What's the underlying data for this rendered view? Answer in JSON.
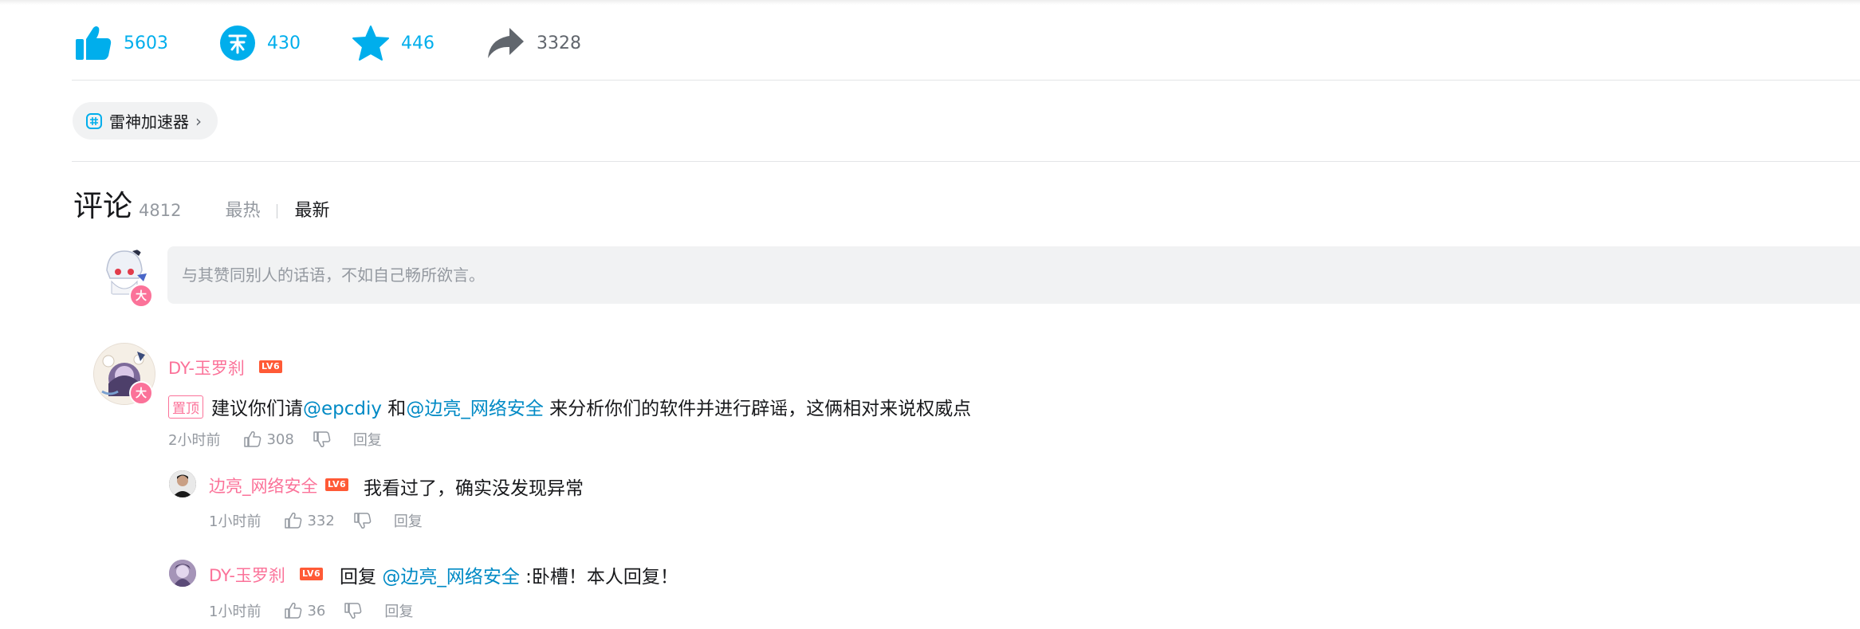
{
  "toolbar": {
    "like_count": "5603",
    "coin_count": "430",
    "favorite_count": "446",
    "share_count": "3328",
    "coin_glyph": "币",
    "accent_color": "#00aeec"
  },
  "tag": {
    "label": "雷神加速器"
  },
  "comments": {
    "title": "评论",
    "count": "4812",
    "sort_hot": "最热",
    "sort_new": "最新",
    "reply_placeholder": "与其赞同别人的话语，不如自己畅所欲言。",
    "avatar_badge": "大"
  },
  "comment_list": [
    {
      "username": "DY-玉罗刹",
      "level": "LV6",
      "pin_label": "置顶",
      "text_1": "建议你们请",
      "mention_1": "@epcdiy",
      "text_2": " 和",
      "mention_2": "@边亮_网络安全",
      "text_3": " 来分析你们的软件并进行辟谣，这俩相对来说权威点",
      "time": "2小时前",
      "likes": "308",
      "reply_label": "回复",
      "replies": [
        {
          "username": "边亮_网络安全",
          "level": "LV6",
          "text": "我看过了，确实没发现异常",
          "time": "1小时前",
          "likes": "332",
          "reply_label": "回复"
        },
        {
          "username": "DY-玉罗刹",
          "level": "LV6",
          "prefix": "回复 ",
          "mention": "@边亮_网络安全",
          "text": " :卧槽！本人回复！",
          "time": "1小时前",
          "likes": "36",
          "reply_label": "回复"
        }
      ]
    }
  ]
}
